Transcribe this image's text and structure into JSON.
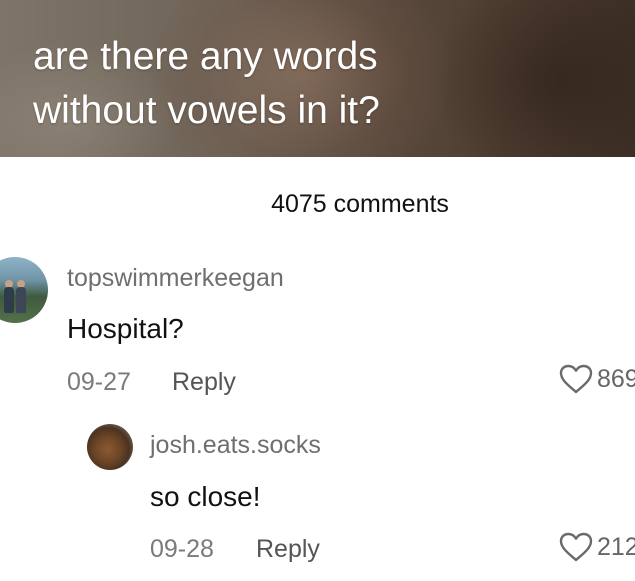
{
  "video": {
    "caption": "are there any words\nwithout vowels in it?"
  },
  "comments_header": {
    "count_label": "4075 comments"
  },
  "comments": [
    {
      "username": "topswimmerkeegan",
      "text": "Hospital?",
      "date": "09-27",
      "reply_label": "Reply",
      "likes": "869"
    }
  ],
  "replies": [
    {
      "username": "josh.eats.socks",
      "text": "so close!",
      "date": "09-28",
      "reply_label": "Reply",
      "likes": "212"
    }
  ],
  "icons": {
    "like": "heart-outline-icon"
  },
  "colors": {
    "username": "#6f6f6f",
    "meta": "#7a7a7a",
    "text": "#111111"
  }
}
